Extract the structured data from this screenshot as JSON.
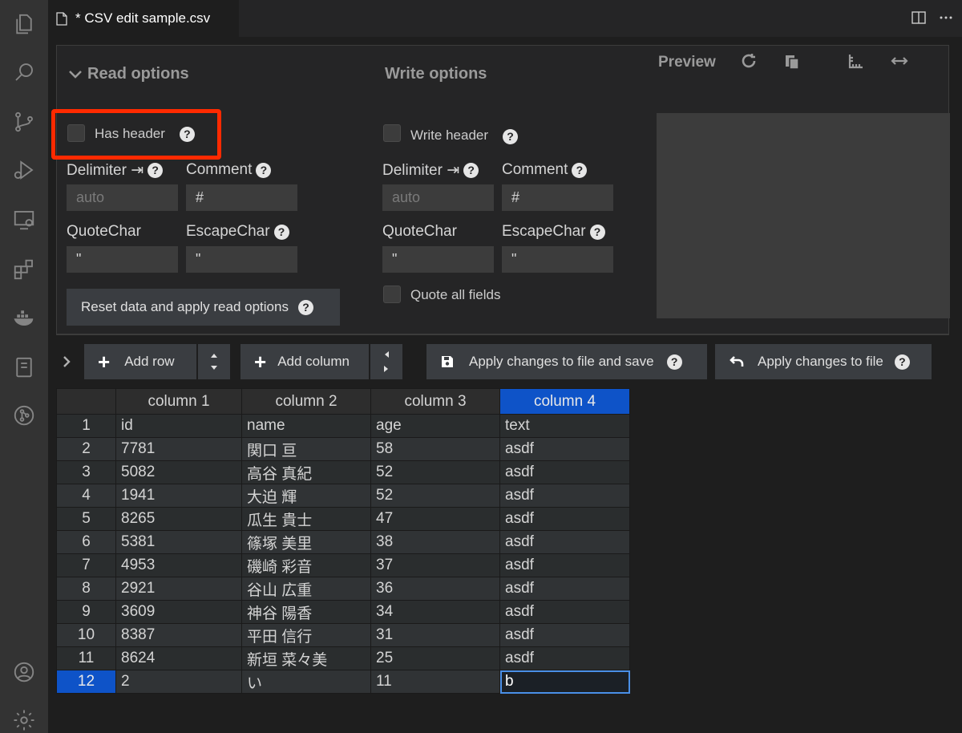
{
  "tab": {
    "title": "* CSV edit sample.csv"
  },
  "read_options": {
    "title": "Read options",
    "has_header_label": "Has header",
    "delimiter_label": "Delimiter ⇥",
    "delimiter_placeholder": "auto",
    "comment_label": "Comment",
    "comment_value": "#",
    "quotechar_label": "QuoteChar",
    "quotechar_value": "\"",
    "escapechar_label": "EscapeChar",
    "escapechar_value": "\"",
    "reset_button_label": "Reset data and apply read options"
  },
  "write_options": {
    "title": "Write options",
    "write_header_label": "Write header",
    "delimiter_label": "Delimiter ⇥",
    "delimiter_placeholder": "auto",
    "comment_label": "Comment",
    "comment_value": "#",
    "quotechar_label": "QuoteChar",
    "quotechar_value": "\"",
    "escapechar_label": "EscapeChar",
    "escapechar_value": "\"",
    "quote_all_label": "Quote all fields"
  },
  "preview": {
    "title": "Preview"
  },
  "toolbar": {
    "add_row_label": "Add row",
    "add_column_label": "Add column",
    "apply_save_label": "Apply changes to file and save",
    "apply_label": "Apply changes to file"
  },
  "table": {
    "columns": [
      "column 1",
      "column 2",
      "column 3",
      "column 4"
    ],
    "rows": [
      [
        "1",
        "id",
        "name",
        "age",
        "text"
      ],
      [
        "2",
        "7781",
        "関口 亘",
        "58",
        "asdf"
      ],
      [
        "3",
        "5082",
        "高谷 真紀",
        "52",
        "asdf"
      ],
      [
        "4",
        "1941",
        "大迫 輝",
        "52",
        "asdf"
      ],
      [
        "5",
        "8265",
        "瓜生 貴士",
        "47",
        "asdf"
      ],
      [
        "6",
        "5381",
        "篠塚 美里",
        "38",
        "asdf"
      ],
      [
        "7",
        "4953",
        "磯崎 彩音",
        "37",
        "asdf"
      ],
      [
        "8",
        "2921",
        "谷山 広重",
        "36",
        "asdf"
      ],
      [
        "9",
        "3609",
        "神谷 陽香",
        "34",
        "asdf"
      ],
      [
        "10",
        "8387",
        "平田 信行",
        "31",
        "asdf"
      ],
      [
        "11",
        "8624",
        "新垣 菜々美",
        "25",
        "asdf"
      ],
      [
        "12",
        "2",
        "い",
        "11",
        "b"
      ]
    ]
  },
  "colors": {
    "accent": "#0e53c8",
    "highlight": "#ff2a00"
  }
}
